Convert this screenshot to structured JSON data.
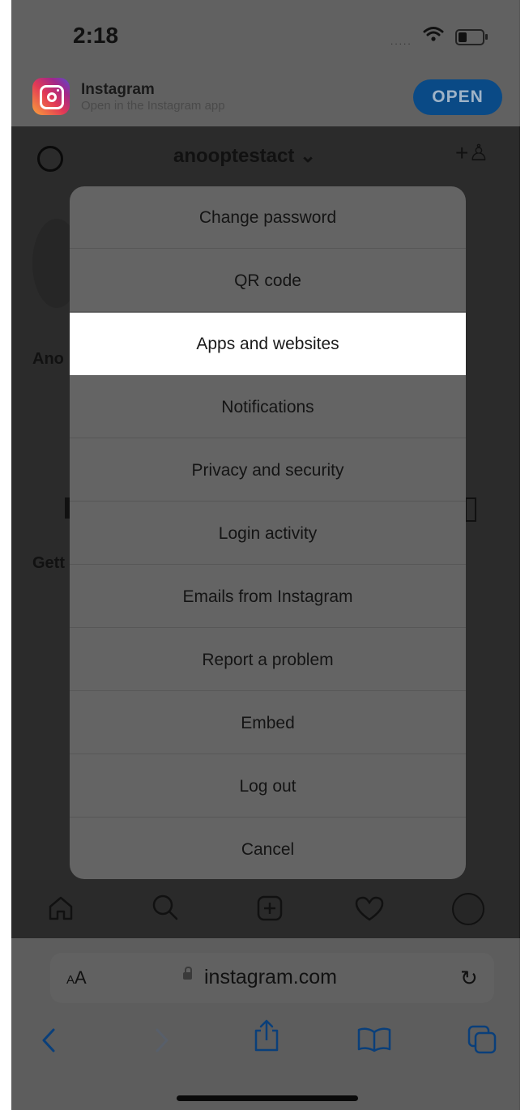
{
  "status_bar": {
    "time": "2:18",
    "signal_text": "....."
  },
  "app_banner": {
    "title": "Instagram",
    "subtitle": "Open in the Instagram app",
    "open_label": "OPEN"
  },
  "profile_header": {
    "username": "anooptestact ⌄",
    "add_user_glyph": "+♙"
  },
  "background_fragments": {
    "name_fragment": "Ano",
    "getting_fragment": "Gett"
  },
  "action_sheet": {
    "items": [
      {
        "label": "Change password"
      },
      {
        "label": "QR code"
      },
      {
        "label": "Apps and websites",
        "highlighted": true
      },
      {
        "label": "Notifications"
      },
      {
        "label": "Privacy and security"
      },
      {
        "label": "Login activity"
      },
      {
        "label": "Emails from Instagram"
      },
      {
        "label": "Report a problem"
      },
      {
        "label": "Embed"
      },
      {
        "label": "Log out"
      },
      {
        "label": "Cancel"
      }
    ]
  },
  "tab_bar": {
    "icons": [
      "home-icon",
      "search-icon",
      "new-post-icon",
      "activity-heart-icon",
      "profile-avatar-icon"
    ]
  },
  "safari": {
    "text_size_label": "AA",
    "url": "instagram.com",
    "reload_glyph": "↻",
    "nav_icons": [
      "back-icon",
      "forward-icon",
      "share-icon",
      "bookmarks-icon",
      "tabs-icon"
    ]
  },
  "colors": {
    "open_button": "#0a4a86",
    "highlight_row": "#ffffff",
    "sheet_bg": "#646464"
  }
}
